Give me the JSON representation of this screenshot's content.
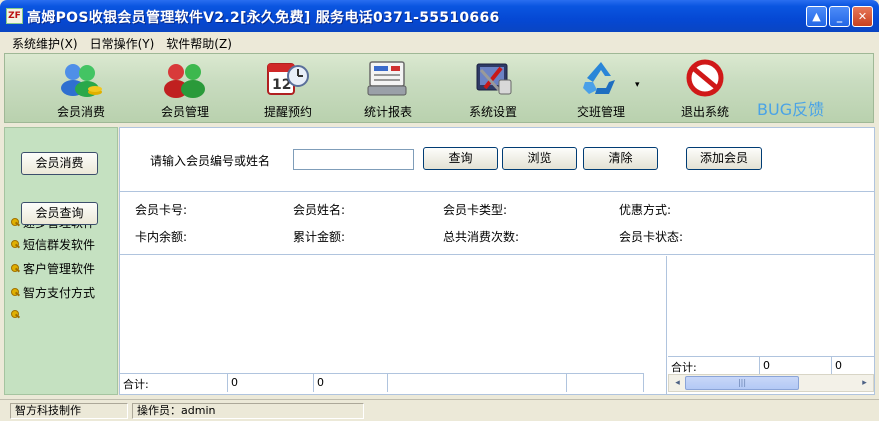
{
  "window": {
    "icon_text": "ZF",
    "title": "高姆POS收银会员管理软件V2.2[永久免费] 服务电话0371-55510666"
  },
  "menu": [
    {
      "label": "系统维护(X)"
    },
    {
      "label": "日常操作(Y)"
    },
    {
      "label": "软件帮助(Z)"
    }
  ],
  "toolbar": {
    "items": [
      {
        "label": "会员消费",
        "icon": "users-coins-icon"
      },
      {
        "label": "会员管理",
        "icon": "people-icon"
      },
      {
        "label": "提醒预约",
        "icon": "calendar-clock-icon"
      },
      {
        "label": "统计报表",
        "icon": "cash-register-icon"
      },
      {
        "label": "系统设置",
        "icon": "settings-tools-icon"
      },
      {
        "label": "交班管理",
        "icon": "recycle-icon"
      },
      {
        "label": "退出系统",
        "icon": "exit-no-icon"
      }
    ],
    "bug_link": "BUG反馈"
  },
  "sidebar": {
    "buttons": [
      "会员消费",
      "会员查询"
    ],
    "links": [
      "速多管理软件",
      "短信群发软件",
      "客户管理软件",
      "智方支付方式"
    ]
  },
  "search": {
    "label": "请输入会员编号或姓名",
    "value": "",
    "buttons": [
      "查询",
      "浏览",
      "清除",
      "添加会员"
    ]
  },
  "member_info": {
    "row1": [
      "会员卡号:",
      "会员姓名:",
      "会员卡类型:",
      "优惠方式:"
    ],
    "row2": [
      "卡内余额:",
      "累计金额:",
      "总共消费次数:",
      "会员卡状态:"
    ]
  },
  "left_grid_totals": [
    "合计:",
    "0",
    "0",
    "",
    ""
  ],
  "right_grid_totals": [
    "合计:",
    "0",
    "0"
  ],
  "statusbar": {
    "company": "智方科技制作",
    "operator": "操作员：admin"
  },
  "colors": {
    "titlebar": "#0548d4",
    "toolbar_bg": "#c9dcc0",
    "sidebar_bg": "#c5e1c1",
    "bug_link": "#4aa3e6"
  }
}
